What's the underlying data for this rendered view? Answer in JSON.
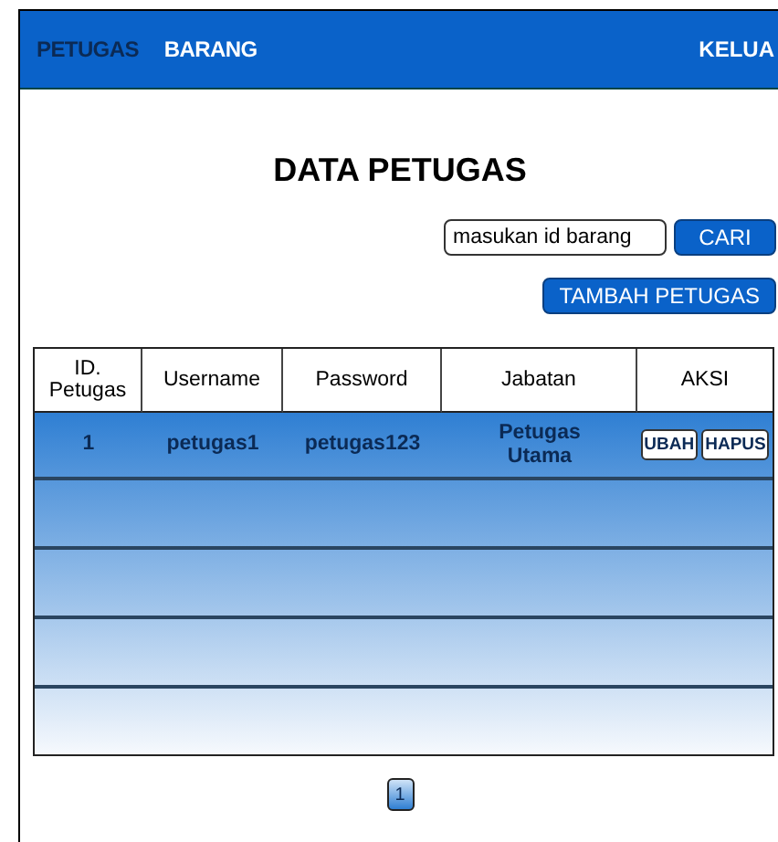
{
  "nav": {
    "items": [
      {
        "label": "PETUGAS",
        "selected": true
      },
      {
        "label": "BARANG",
        "selected": false
      }
    ],
    "logout": "KELUA"
  },
  "title": "DATA PETUGAS",
  "search": {
    "placeholder": "masukan id barang",
    "button": "CARI"
  },
  "add_button": "TAMBAH PETUGAS",
  "table": {
    "columns": [
      "ID.\nPetugas",
      "Username",
      "Password",
      "Jabatan",
      "AKSI"
    ],
    "rows": [
      {
        "id": "1",
        "username": "petugas1",
        "password": "petugas123",
        "jabatan": "Petugas\nUtama",
        "actions": [
          "UBAH",
          "HAPUS"
        ]
      }
    ]
  },
  "pagination": [
    {
      "label": "1",
      "selected": true
    }
  ]
}
